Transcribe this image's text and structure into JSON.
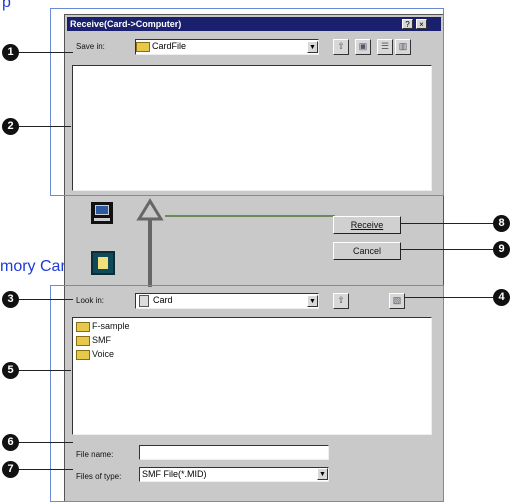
{
  "top_fragment": "p",
  "memory_label": "mory Card",
  "dialog": {
    "title": "Receive(Card->Computer)",
    "help": "?",
    "close": "×"
  },
  "upper": {
    "label": "Save in:",
    "value": "CardFile",
    "tool_icons": [
      "up-folder-icon",
      "new-folder-icon",
      "list-view-icon",
      "details-view-icon"
    ]
  },
  "buttons": {
    "receive": "Receive",
    "cancel": "Cancel"
  },
  "lower": {
    "label": "Look in:",
    "value": "Card",
    "items": [
      {
        "name": "F-sample"
      },
      {
        "name": "SMF"
      },
      {
        "name": "Voice"
      }
    ],
    "file_name_label": "File name:",
    "file_name_value": "",
    "files_type_label": "Files of type:",
    "files_type_value": "SMF File(*.MID)"
  },
  "callouts": [
    "1",
    "2",
    "3",
    "4",
    "5",
    "6",
    "7",
    "8",
    "9"
  ],
  "colors": {
    "title_bar": "#1a1f6e",
    "annotation_blue": "#1f3bd6",
    "dialog_gray": "#c9c9c9"
  }
}
